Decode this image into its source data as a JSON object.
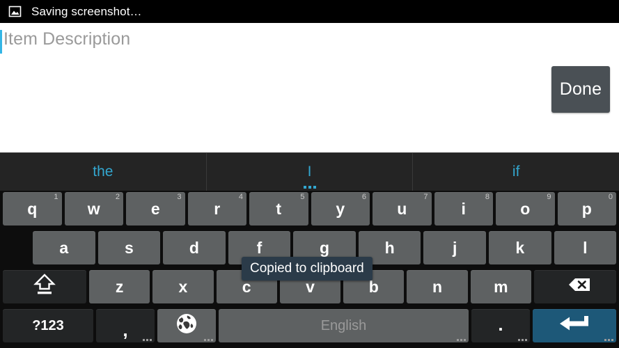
{
  "status_bar": {
    "icon": "image-screenshot-icon",
    "text": "Saving screenshot…",
    "background": "#000000"
  },
  "app": {
    "text_field": {
      "value": "",
      "placeholder": "Item Description",
      "caret_color": "#33b5e5"
    },
    "done_button": {
      "label": "Done",
      "background": "#4a5055"
    }
  },
  "toast": {
    "text": "Copied to clipboard",
    "background": "#2b3b49"
  },
  "keyboard": {
    "accent": "#33a7d0",
    "enter_color": "#1d5878",
    "suggestions": [
      {
        "label": "the",
        "has_more": false
      },
      {
        "label": "I",
        "has_more": true
      },
      {
        "label": "if",
        "has_more": false
      }
    ],
    "row1": [
      {
        "label": "q",
        "num": "1"
      },
      {
        "label": "w",
        "num": "2"
      },
      {
        "label": "e",
        "num": "3"
      },
      {
        "label": "r",
        "num": "4"
      },
      {
        "label": "t",
        "num": "5"
      },
      {
        "label": "y",
        "num": "6"
      },
      {
        "label": "u",
        "num": "7"
      },
      {
        "label": "i",
        "num": "8"
      },
      {
        "label": "o",
        "num": "9"
      },
      {
        "label": "p",
        "num": "0"
      }
    ],
    "row2": [
      {
        "label": "a"
      },
      {
        "label": "s"
      },
      {
        "label": "d"
      },
      {
        "label": "f"
      },
      {
        "label": "g"
      },
      {
        "label": "h"
      },
      {
        "label": "j"
      },
      {
        "label": "k"
      },
      {
        "label": "l"
      }
    ],
    "row3": {
      "shift": {
        "icon": "shift-arrow-icon"
      },
      "letters": [
        {
          "label": "z"
        },
        {
          "label": "x"
        },
        {
          "label": "c"
        },
        {
          "label": "v"
        },
        {
          "label": "b"
        },
        {
          "label": "n"
        },
        {
          "label": "m"
        }
      ],
      "backspace": {
        "icon": "backspace-delete-icon"
      }
    },
    "row4": {
      "symbols": {
        "label": "?123"
      },
      "comma": {
        "label": ",",
        "has_more": true
      },
      "globe": {
        "icon": "globe-language-icon",
        "has_more": true
      },
      "space": {
        "label": "English",
        "has_more": true
      },
      "period": {
        "label": ".",
        "has_more": true
      },
      "enter": {
        "icon": "enter-return-icon",
        "has_more": true
      }
    }
  }
}
